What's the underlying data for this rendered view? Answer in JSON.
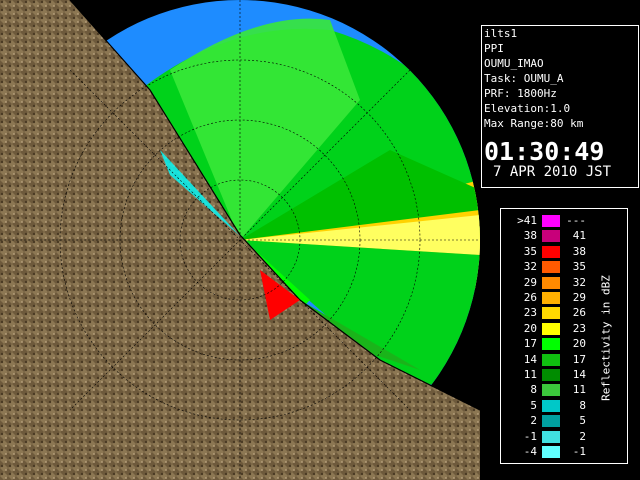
{
  "info": {
    "site": "ilts1",
    "scan_type": "PPI",
    "product": "OUMU_IMAO",
    "task": "Task: OUMU_A",
    "prf": "PRF: 1800Hz",
    "elevation": "Elevation:1.0",
    "max_range": "Max Range:80 km",
    "time": "01:30:49",
    "date": "7 APR 2010 JST"
  },
  "legend": {
    "title": "Reflectivity in dBZ",
    "left_labels": [
      ">41",
      "38",
      "35",
      "32",
      "29",
      "26",
      "23",
      "20",
      "17",
      "14",
      "11",
      "8",
      "5",
      "2",
      "-1",
      "-4"
    ],
    "right_labels": [
      "---",
      "41",
      "38",
      "35",
      "32",
      "29",
      "26",
      "23",
      "20",
      "17",
      "14",
      "11",
      "8",
      "5",
      "2",
      "-1"
    ],
    "colors": [
      "#ff00ff",
      "#c8007a",
      "#ff0000",
      "#ff5a00",
      "#ff8a00",
      "#ffb000",
      "#ffd800",
      "#ffff00",
      "#00ff00",
      "#10c010",
      "#008c00",
      "#3cc83c",
      "#00c8c8",
      "#00a0a0",
      "#40e0e0",
      "#60ffff"
    ]
  },
  "colors": {
    "background": "#000000",
    "range_circle": "#1e8cff",
    "land": "#8c7a5a",
    "sea": "#000000"
  }
}
